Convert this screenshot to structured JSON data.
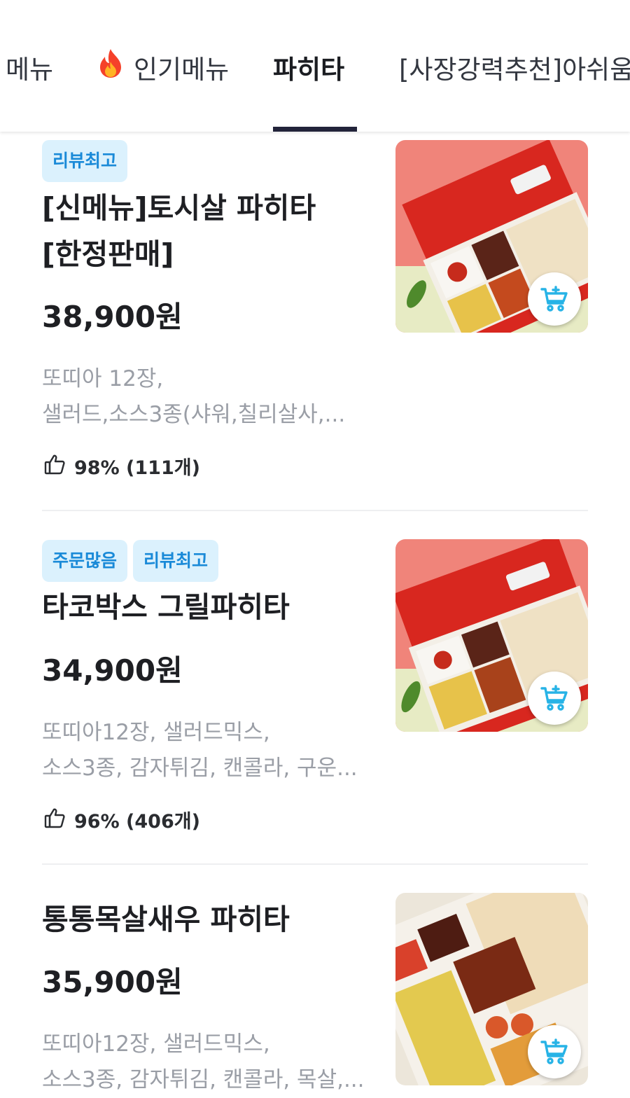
{
  "tabs": [
    {
      "label": "메뉴",
      "active": false
    },
    {
      "label": "인기메뉴",
      "active": false,
      "icon": "fire-icon"
    },
    {
      "label": "파히타",
      "active": true
    },
    {
      "label": "[사장강력추천]아쉬움",
      "active": false
    }
  ],
  "menu_items": [
    {
      "badges": [
        "리뷰최고"
      ],
      "name": "[신메뉴]토시살 파히타\n[한정판매]",
      "price": "38,900원",
      "desc_line1": "또띠아 12장,",
      "desc_line2": "샐러드,소스3종(샤워,칠리살사,...",
      "rating": "98% (111개)",
      "image_icon": "fajita-box-photo",
      "cart_icon": "add-to-cart-icon"
    },
    {
      "badges": [
        "주문많음",
        "리뷰최고"
      ],
      "name": "타코박스 그릴파히타",
      "price": "34,900원",
      "desc_line1": "또띠아12장, 샐러드믹스,",
      "desc_line2": "소스3종, 감자튀김, 캔콜라, 구운...",
      "rating": "96% (406개)",
      "image_icon": "fajita-box-photo",
      "cart_icon": "add-to-cart-icon"
    },
    {
      "badges": [],
      "name": "통통목살새우 파히타",
      "price": "35,900원",
      "desc_line1": "또띠아12장, 샐러드믹스,",
      "desc_line2": "소스3종, 감자튀김, 캔콜라, 목살,...",
      "rating": "",
      "image_icon": "fajita-box-photo",
      "cart_icon": "add-to-cart-icon"
    }
  ],
  "colors": {
    "badge_bg": "#dbf1fd",
    "badge_text": "#1a8ad8",
    "tab_indicator": "#22243a",
    "cart_icon": "#27b3e6",
    "box_red": "#e0302a"
  }
}
